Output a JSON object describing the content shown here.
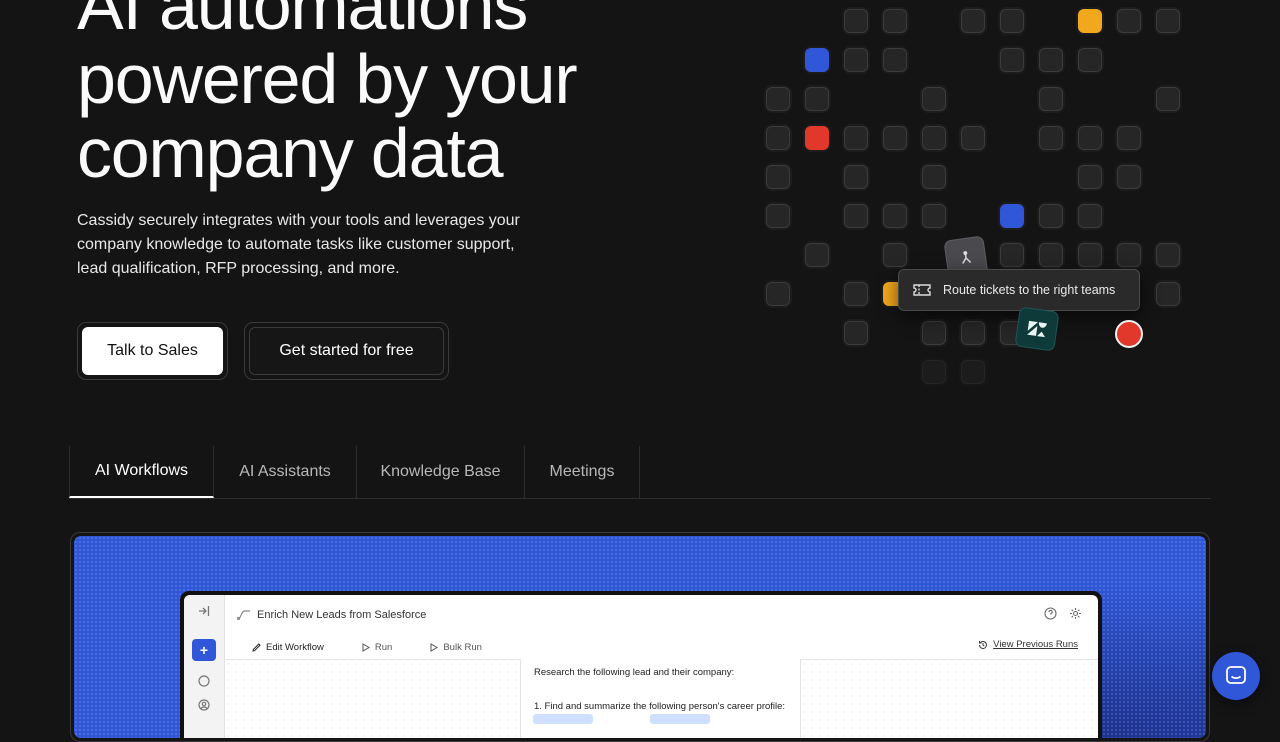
{
  "hero": {
    "title_line1": "AI automations",
    "title_line2": "powered by your",
    "title_line3": "company data",
    "subtitle": "Cassidy securely integrates with your tools and leverages your company knowledge to automate tasks like customer support, lead qualification, RFP processing, and more."
  },
  "cta": {
    "talk_to_sales": "Talk to Sales",
    "get_started": "Get started for free"
  },
  "floating_card": {
    "label": "Route tickets to the right teams",
    "icon": "ticket-icon"
  },
  "colors": {
    "accent_blue": "#2f57d8",
    "accent_red": "#e1382b",
    "accent_yellow": "#f2a81d"
  },
  "tabs": [
    {
      "label": "AI Workflows",
      "active": true
    },
    {
      "label": "AI Assistants",
      "active": false
    },
    {
      "label": "Knowledge Base",
      "active": false
    },
    {
      "label": "Meetings",
      "active": false
    }
  ],
  "demo_app": {
    "workflow_title": "Enrich New Leads from Salesforce",
    "sub_tabs": {
      "edit": "Edit Workflow",
      "run": "Run",
      "bulk_run": "Bulk Run"
    },
    "view_previous_runs": "View Previous Runs",
    "editor_line1": "Research the following lead and their company:",
    "editor_line2": "1. Find and summarize the following person's career profile:"
  }
}
